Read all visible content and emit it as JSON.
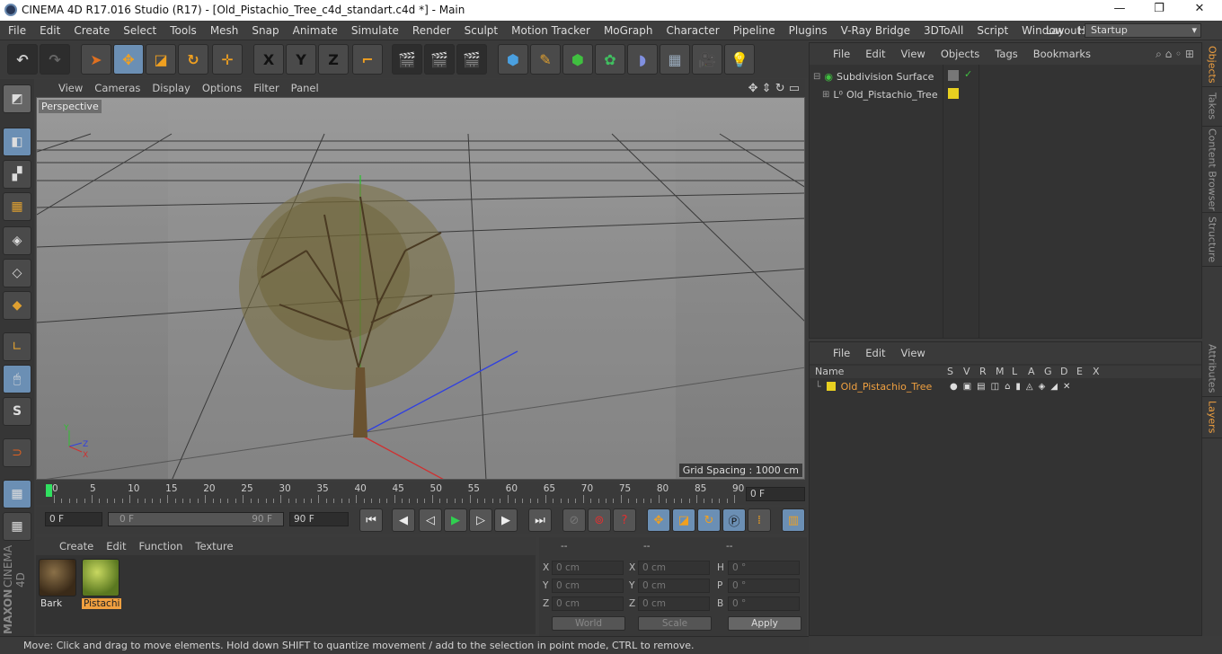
{
  "window": {
    "title": "CINEMA 4D R17.016 Studio (R17) - [Old_Pistachio_Tree_c4d_standart.c4d *] - Main"
  },
  "menubar": [
    "File",
    "Edit",
    "Create",
    "Select",
    "Tools",
    "Mesh",
    "Snap",
    "Animate",
    "Simulate",
    "Render",
    "Sculpt",
    "Motion Tracker",
    "MoGraph",
    "Character",
    "Pipeline",
    "Plugins",
    "V-Ray Bridge",
    "3DToAll",
    "Script",
    "Window",
    "Help"
  ],
  "layout": {
    "label": "Layout:",
    "value": "Startup"
  },
  "toolbar": {
    "x": "X",
    "y": "Y",
    "z": "Z"
  },
  "viewport": {
    "menu": [
      "View",
      "Cameras",
      "Display",
      "Options",
      "Filter",
      "Panel"
    ],
    "label": "Perspective",
    "grid_spacing": "Grid Spacing : 1000 cm",
    "axis": {
      "x": "X",
      "y": "Y",
      "z": "Z"
    }
  },
  "timeline": {
    "ticks": [
      "0",
      "5",
      "10",
      "15",
      "20",
      "25",
      "30",
      "35",
      "40",
      "45",
      "50",
      "55",
      "60",
      "65",
      "70",
      "75",
      "80",
      "85",
      "90"
    ],
    "current_frame": "0 F",
    "start": "0 F",
    "range_start": "0 F",
    "range_end": "90 F",
    "end": "90 F"
  },
  "material_manager": {
    "menu": [
      "Create",
      "Edit",
      "Function",
      "Texture"
    ],
    "materials": [
      {
        "name": "Bark"
      },
      {
        "name": "Pistachi"
      }
    ]
  },
  "coordinates": {
    "headers": [
      "--",
      "--",
      "--"
    ],
    "rows": [
      {
        "a": "X",
        "av": "0 cm",
        "b": "X",
        "bv": "0 cm",
        "c": "H",
        "cv": "0 °"
      },
      {
        "a": "Y",
        "av": "0 cm",
        "b": "Y",
        "bv": "0 cm",
        "c": "P",
        "cv": "0 °"
      },
      {
        "a": "Z",
        "av": "0 cm",
        "b": "Z",
        "bv": "0 cm",
        "c": "B",
        "cv": "0 °"
      }
    ],
    "world": "World",
    "scale": "Scale",
    "apply": "Apply"
  },
  "objects_panel": {
    "menu": [
      "File",
      "Edit",
      "View",
      "Objects",
      "Tags",
      "Bookmarks"
    ],
    "items": [
      {
        "name": "Subdivision Surface"
      },
      {
        "name": "Old_Pistachio_Tree"
      }
    ]
  },
  "layers_panel": {
    "menu": [
      "File",
      "Edit",
      "View"
    ],
    "columns": {
      "name": "Name",
      "flags": [
        "S",
        "V",
        "R",
        "M",
        "L",
        "A",
        "G",
        "D",
        "E",
        "X"
      ]
    },
    "layer": {
      "name": "Old_Pistachio_Tree"
    }
  },
  "side_tabs": [
    "Objects",
    "Takes",
    "Content Browser",
    "Structure",
    "Attributes",
    "Layers"
  ],
  "status": "Move: Click and drag to move elements. Hold down SHIFT to quantize movement / add to the selection in point mode, CTRL to remove.",
  "brand": {
    "maxon": "MAXON",
    "product": "CINEMA 4D"
  },
  "colors": {
    "accent": "#6b8fb4",
    "layer_yellow": "#e8d020",
    "active_tab": "#f0a040"
  }
}
